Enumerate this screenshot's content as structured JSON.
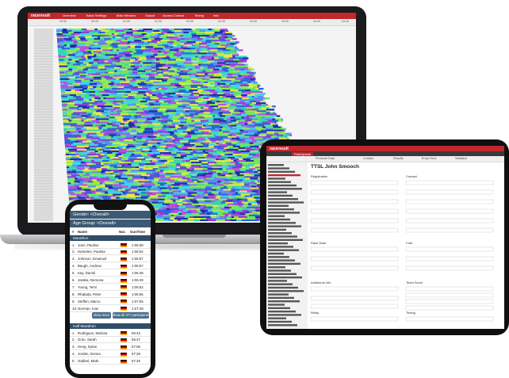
{
  "laptop": {
    "brand": "raceresult",
    "nav": [
      "Overview",
      "Basic Settings",
      "Main Window",
      "Output",
      "Access Control",
      "Timing",
      "Info"
    ],
    "timeline_labels": [
      "00:00",
      "00:30",
      "01:00",
      "01:30",
      "02:00",
      "02:30",
      "03:00",
      "03:30",
      "04:00",
      "04:30"
    ]
  },
  "phone": {
    "gender_filter": "Gender: <Overall>",
    "age_filter": "Age Group: <Overall>",
    "col_rank": "#",
    "col_name": "Name",
    "col_nat": "Nat.",
    "col_time": "GunTime",
    "section1": "Marathon",
    "rows1": [
      {
        "rank": "1.",
        "name": "Jonn, Pauline",
        "time": "1:06:38"
      },
      {
        "rank": "2.",
        "name": "Hamelen, Paulina",
        "time": "1:06:52"
      },
      {
        "rank": "3.",
        "name": "Johnson, Emanuel",
        "time": "1:06:57"
      },
      {
        "rank": "4.",
        "name": "Baugh, Andrew",
        "time": "1:06:57"
      },
      {
        "rank": "5.",
        "name": "Kay, Daniel",
        "time": "1:06:48"
      },
      {
        "rank": "6.",
        "name": "Jaraba, Demona",
        "time": "1:06:49"
      },
      {
        "rank": "7.",
        "name": "Young, Temi",
        "time": "1:06:52"
      },
      {
        "rank": "8.",
        "name": "Rhabata, Peter",
        "time": "1:06:55"
      },
      {
        "rank": "9.",
        "name": "Steffen, Marco",
        "time": "1:07:06"
      },
      {
        "rank": "10.",
        "name": "Norman, Ivan",
        "time": "1:07:48"
      }
    ],
    "btn_show_more": "show more",
    "btn_show_all": "show all 377 participants",
    "section2": "Half Marathon",
    "rows2": [
      {
        "rank": "1.",
        "name": "Rodrigues, Melissa",
        "time": "56:43"
      },
      {
        "rank": "2.",
        "name": "Goto, Sarah",
        "time": "56:47"
      },
      {
        "rank": "3.",
        "name": "Heng, Dylan",
        "time": "57:06"
      },
      {
        "rank": "4.",
        "name": "Jordan, Donna",
        "time": "57:28"
      },
      {
        "rank": "5.",
        "name": "Gabbel, Mark",
        "time": "57:46"
      }
    ]
  },
  "tablet": {
    "brand": "raceresult",
    "tab_active": "Participants",
    "participant_title": "TTSL John Smooch",
    "tabs": [
      "Personal Data",
      "Contact",
      "Results",
      "Entry Fees",
      "Statistics"
    ],
    "sections": [
      "Registration",
      "Contact",
      "Race Data",
      "Additional Info",
      "Relay",
      "Club",
      "Team Score",
      "Timing"
    ]
  },
  "colors": {
    "brand_red": "#c0282d",
    "phone_header": "#3d5a73",
    "section_header": "#2f4d68"
  }
}
